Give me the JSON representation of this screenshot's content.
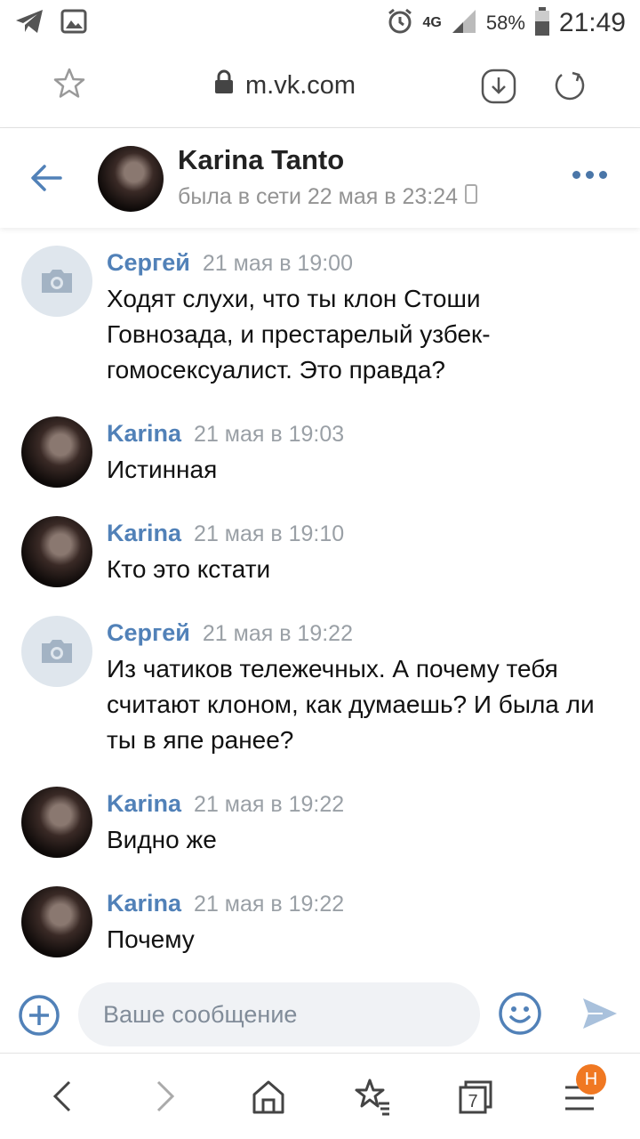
{
  "status_bar": {
    "network": "4G",
    "battery": "58%",
    "time": "21:49"
  },
  "browser": {
    "url": "m.vk.com"
  },
  "chat": {
    "name": "Karina Tanto",
    "status": "была в сети 22 мая в 23:24"
  },
  "messages": [
    {
      "author": "Сергей",
      "time": "21 мая в 19:00",
      "text": "Ходят слухи, что ты клон Стоши Говнозада, и престарелый узбек-гомосексуалист. Это правда?",
      "avatar": "camera"
    },
    {
      "author": "Karina",
      "time": "21 мая в 19:03",
      "text": "Истинная",
      "avatar": "photo"
    },
    {
      "author": "Karina",
      "time": "21 мая в 19:10",
      "text": "Кто это кстати",
      "avatar": "photo"
    },
    {
      "author": "Сергей",
      "time": "21 мая в 19:22",
      "text": "Из чатиков тележечных. А почему тебя считают клоном, как думаешь? И была ли ты в япе ранее?",
      "avatar": "camera"
    },
    {
      "author": "Karina",
      "time": "21 мая в 19:22",
      "text": "Видно же",
      "avatar": "photo"
    },
    {
      "author": "Karina",
      "time": "21 мая в 19:22",
      "text": "Почему",
      "avatar": "photo"
    }
  ],
  "composer": {
    "placeholder": "Ваше сообщение"
  },
  "nav": {
    "tabs_count": "7",
    "menu_badge": "Н"
  },
  "colors": {
    "accent": "#5181b8",
    "badge": "#f07822"
  }
}
